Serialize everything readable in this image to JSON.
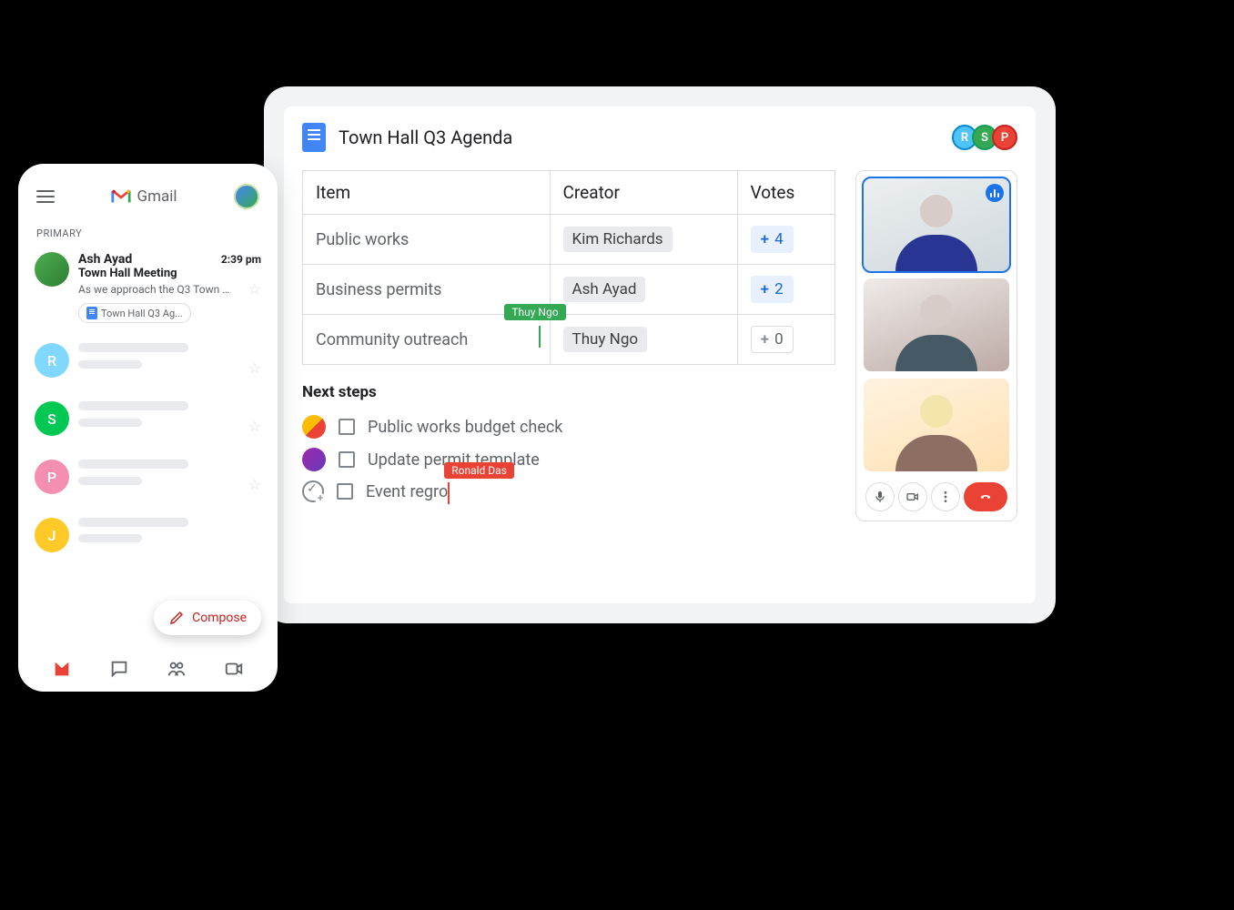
{
  "gmail": {
    "brand": "Gmail",
    "primary_label": "PRIMARY",
    "compose_label": "Compose",
    "first_email": {
      "sender": "Ash Ayad",
      "time": "2:39 pm",
      "subject": "Town Hall Meeting",
      "preview": "As we approach the Q3 Town Ha...",
      "attachment": "Town Hall Q3 Ag..."
    },
    "placeholder_initials": [
      "R",
      "S",
      "P",
      "J"
    ],
    "placeholder_colors": [
      "#80d8ff",
      "#00c853",
      "#f48fb1",
      "#ffca28"
    ]
  },
  "docs": {
    "title": "Town Hall Q3 Agenda",
    "collaborators": [
      {
        "initial": "R",
        "color": "#4fc3f7"
      },
      {
        "initial": "S",
        "color": "#34a853"
      },
      {
        "initial": "P",
        "color": "#ea4335"
      }
    ],
    "table": {
      "headers": [
        "Item",
        "Creator",
        "Votes"
      ],
      "rows": [
        {
          "item": "Public works",
          "creator": "Kim Richards",
          "votes": 4,
          "active": true
        },
        {
          "item": "Business permits",
          "creator": "Ash Ayad",
          "votes": 2,
          "active": true
        },
        {
          "item": "Community outreach",
          "creator": "Thuy Ngo",
          "votes": 0,
          "active": false
        }
      ]
    },
    "cursors": {
      "green": "Thuy Ngo",
      "red": "Ronald Das"
    },
    "next_steps": {
      "heading": "Next steps",
      "tasks": [
        {
          "text": "Public works budget check"
        },
        {
          "text": "Update permit template"
        },
        {
          "text": "Event regro"
        }
      ]
    }
  }
}
